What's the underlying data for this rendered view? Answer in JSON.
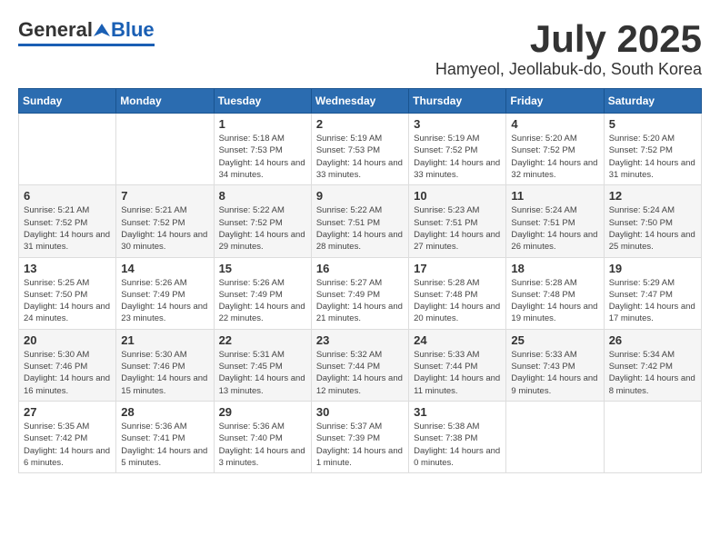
{
  "header": {
    "logo": {
      "general": "General",
      "blue": "Blue"
    },
    "month": "July 2025",
    "location": "Hamyeol, Jeollabuk-do, South Korea"
  },
  "weekdays": [
    "Sunday",
    "Monday",
    "Tuesday",
    "Wednesday",
    "Thursday",
    "Friday",
    "Saturday"
  ],
  "weeks": [
    [
      {
        "day": "",
        "info": ""
      },
      {
        "day": "",
        "info": ""
      },
      {
        "day": "1",
        "info": "Sunrise: 5:18 AM\nSunset: 7:53 PM\nDaylight: 14 hours and 34 minutes."
      },
      {
        "day": "2",
        "info": "Sunrise: 5:19 AM\nSunset: 7:53 PM\nDaylight: 14 hours and 33 minutes."
      },
      {
        "day": "3",
        "info": "Sunrise: 5:19 AM\nSunset: 7:52 PM\nDaylight: 14 hours and 33 minutes."
      },
      {
        "day": "4",
        "info": "Sunrise: 5:20 AM\nSunset: 7:52 PM\nDaylight: 14 hours and 32 minutes."
      },
      {
        "day": "5",
        "info": "Sunrise: 5:20 AM\nSunset: 7:52 PM\nDaylight: 14 hours and 31 minutes."
      }
    ],
    [
      {
        "day": "6",
        "info": "Sunrise: 5:21 AM\nSunset: 7:52 PM\nDaylight: 14 hours and 31 minutes."
      },
      {
        "day": "7",
        "info": "Sunrise: 5:21 AM\nSunset: 7:52 PM\nDaylight: 14 hours and 30 minutes."
      },
      {
        "day": "8",
        "info": "Sunrise: 5:22 AM\nSunset: 7:52 PM\nDaylight: 14 hours and 29 minutes."
      },
      {
        "day": "9",
        "info": "Sunrise: 5:22 AM\nSunset: 7:51 PM\nDaylight: 14 hours and 28 minutes."
      },
      {
        "day": "10",
        "info": "Sunrise: 5:23 AM\nSunset: 7:51 PM\nDaylight: 14 hours and 27 minutes."
      },
      {
        "day": "11",
        "info": "Sunrise: 5:24 AM\nSunset: 7:51 PM\nDaylight: 14 hours and 26 minutes."
      },
      {
        "day": "12",
        "info": "Sunrise: 5:24 AM\nSunset: 7:50 PM\nDaylight: 14 hours and 25 minutes."
      }
    ],
    [
      {
        "day": "13",
        "info": "Sunrise: 5:25 AM\nSunset: 7:50 PM\nDaylight: 14 hours and 24 minutes."
      },
      {
        "day": "14",
        "info": "Sunrise: 5:26 AM\nSunset: 7:49 PM\nDaylight: 14 hours and 23 minutes."
      },
      {
        "day": "15",
        "info": "Sunrise: 5:26 AM\nSunset: 7:49 PM\nDaylight: 14 hours and 22 minutes."
      },
      {
        "day": "16",
        "info": "Sunrise: 5:27 AM\nSunset: 7:49 PM\nDaylight: 14 hours and 21 minutes."
      },
      {
        "day": "17",
        "info": "Sunrise: 5:28 AM\nSunset: 7:48 PM\nDaylight: 14 hours and 20 minutes."
      },
      {
        "day": "18",
        "info": "Sunrise: 5:28 AM\nSunset: 7:48 PM\nDaylight: 14 hours and 19 minutes."
      },
      {
        "day": "19",
        "info": "Sunrise: 5:29 AM\nSunset: 7:47 PM\nDaylight: 14 hours and 17 minutes."
      }
    ],
    [
      {
        "day": "20",
        "info": "Sunrise: 5:30 AM\nSunset: 7:46 PM\nDaylight: 14 hours and 16 minutes."
      },
      {
        "day": "21",
        "info": "Sunrise: 5:30 AM\nSunset: 7:46 PM\nDaylight: 14 hours and 15 minutes."
      },
      {
        "day": "22",
        "info": "Sunrise: 5:31 AM\nSunset: 7:45 PM\nDaylight: 14 hours and 13 minutes."
      },
      {
        "day": "23",
        "info": "Sunrise: 5:32 AM\nSunset: 7:44 PM\nDaylight: 14 hours and 12 minutes."
      },
      {
        "day": "24",
        "info": "Sunrise: 5:33 AM\nSunset: 7:44 PM\nDaylight: 14 hours and 11 minutes."
      },
      {
        "day": "25",
        "info": "Sunrise: 5:33 AM\nSunset: 7:43 PM\nDaylight: 14 hours and 9 minutes."
      },
      {
        "day": "26",
        "info": "Sunrise: 5:34 AM\nSunset: 7:42 PM\nDaylight: 14 hours and 8 minutes."
      }
    ],
    [
      {
        "day": "27",
        "info": "Sunrise: 5:35 AM\nSunset: 7:42 PM\nDaylight: 14 hours and 6 minutes."
      },
      {
        "day": "28",
        "info": "Sunrise: 5:36 AM\nSunset: 7:41 PM\nDaylight: 14 hours and 5 minutes."
      },
      {
        "day": "29",
        "info": "Sunrise: 5:36 AM\nSunset: 7:40 PM\nDaylight: 14 hours and 3 minutes."
      },
      {
        "day": "30",
        "info": "Sunrise: 5:37 AM\nSunset: 7:39 PM\nDaylight: 14 hours and 1 minute."
      },
      {
        "day": "31",
        "info": "Sunrise: 5:38 AM\nSunset: 7:38 PM\nDaylight: 14 hours and 0 minutes."
      },
      {
        "day": "",
        "info": ""
      },
      {
        "day": "",
        "info": ""
      }
    ]
  ]
}
